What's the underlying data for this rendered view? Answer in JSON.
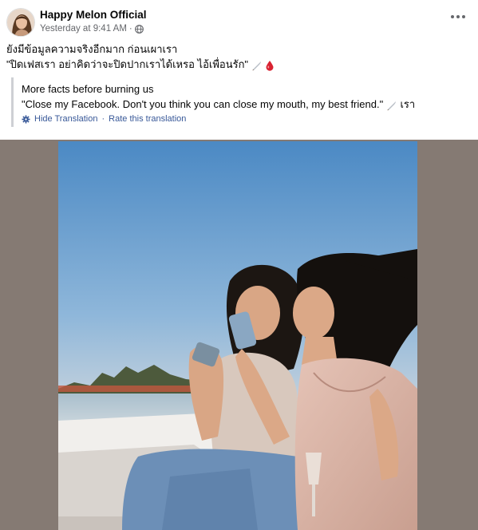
{
  "post": {
    "author": "Happy Melon Official",
    "timestamp": "Yesterday at 9:41 AM",
    "separator": "·",
    "text_line1": "ยังมีข้อมูลความจริงอีกมาก ก่อนเผาเรา",
    "text_line2": "\"ปิดเฟสเรา อย่าคิดว่าจะปิดปากเราได้เหรอ ไอ้เพื่อนรัก\"",
    "icons": [
      "globe-icon",
      "more-options-icon",
      "knife-emoji",
      "blood-drop-emoji",
      "gear-icon"
    ]
  },
  "translation": {
    "line1": "More facts before burning us",
    "line2": "\"Close my Facebook. Don't you think you can close my mouth, my best friend.\"",
    "line2_suffix": "เรา",
    "hide_label": "Hide Translation",
    "separator": "·",
    "rate_label": "Rate this translation"
  },
  "colors": {
    "link": "#385898",
    "meta": "#65676b",
    "photo_background": "#857a73"
  }
}
